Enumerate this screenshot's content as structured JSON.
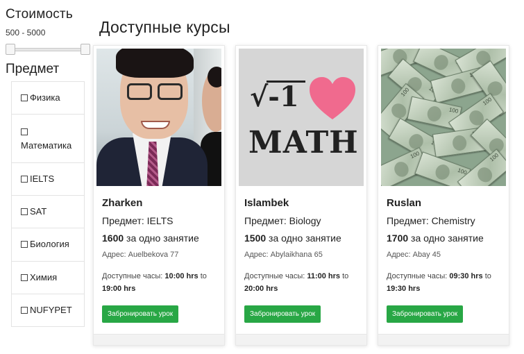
{
  "sidebar": {
    "price_title": "Стоимость",
    "price_range": "500 - 5000",
    "subject_title": "Предмет",
    "subjects": [
      {
        "label": "Физика"
      },
      {
        "label": "Математика"
      },
      {
        "label": "IELTS"
      },
      {
        "label": "SAT"
      },
      {
        "label": "Биология"
      },
      {
        "label": "Химия"
      },
      {
        "label": "NUFYPET"
      }
    ]
  },
  "main": {
    "title": "Доступные курсы",
    "courses": [
      {
        "name": "Zharken",
        "subject": "Предмет: IELTS",
        "price": "1600",
        "price_suffix": " за одно занятие",
        "address": "Адрес: Auelbekova 77",
        "hours_label": "Доступные часы: ",
        "hours_from": "10:00 hrs",
        "hours_to_word": " to ",
        "hours_to": "19:00 hrs",
        "book_label": "Забронировать урок"
      },
      {
        "name": "Islambek",
        "subject": "Предмет: Biology",
        "price": "1500",
        "price_suffix": " за одно занятие",
        "address": "Адрес: Abylaikhana 65",
        "hours_label": "Доступные часы: ",
        "hours_from": "11:00 hrs",
        "hours_to_word": " to ",
        "hours_to": "20:00 hrs",
        "book_label": "Забронировать урок",
        "image_text": {
          "sqrt": "√-1",
          "word": "MATH"
        }
      },
      {
        "name": "Ruslan",
        "subject": "Предмет: Chemistry",
        "price": "1700",
        "price_suffix": " за одно занятие",
        "address": "Адрес: Abay 45",
        "hours_label": "Доступные часы: ",
        "hours_from": "09:30 hrs",
        "hours_to_word": " to ",
        "hours_to": "19:30 hrs",
        "book_label": "Забронировать урок"
      }
    ]
  },
  "colors": {
    "book_button": "#28a745",
    "heart": "#f06a8e"
  },
  "icons": [
    "checkbox-icon",
    "slider-handle-icon",
    "heart-icon"
  ]
}
